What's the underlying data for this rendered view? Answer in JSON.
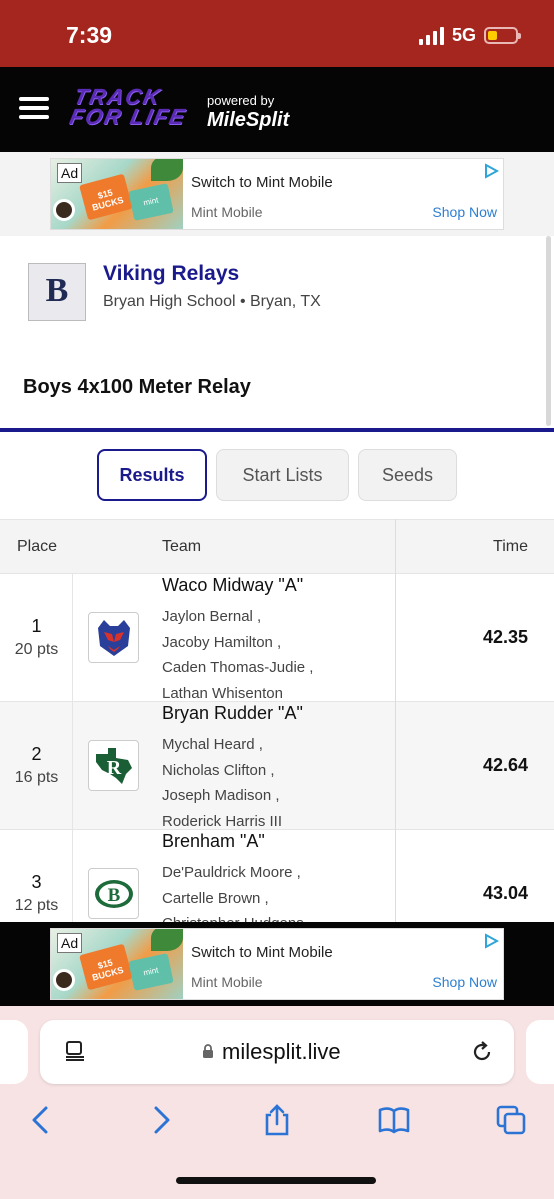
{
  "status": {
    "time": "7:39",
    "network": "5G"
  },
  "header": {
    "logo_line1": "TRACK",
    "logo_line2": "FOR LIFE",
    "powered_by": "powered by",
    "partner": "MileSplit"
  },
  "ad": {
    "badge": "Ad",
    "title": "Switch to Mint Mobile",
    "advertiser": "Mint Mobile",
    "cta": "Shop Now",
    "card1": "$15 BUCKS",
    "card2": "mint"
  },
  "meet": {
    "name": "Viking Relays",
    "location": "Bryan High School • Bryan, TX",
    "logo_letter": "B"
  },
  "event": {
    "title": "Boys 4x100 Meter Relay"
  },
  "tabs": [
    {
      "label": "Results"
    },
    {
      "label": "Start Lists"
    },
    {
      "label": "Seeds"
    }
  ],
  "table": {
    "headers": {
      "place": "Place",
      "team": "Team",
      "time": "Time"
    },
    "rows": [
      {
        "place": "1",
        "points": "20 pts",
        "team": "Waco Midway \"A\"",
        "athletes": [
          "Jaylon Bernal ,",
          "Jacoby Hamilton ,",
          "Caden Thomas-Judie ,",
          "Lathan Whisenton"
        ],
        "time": "42.35"
      },
      {
        "place": "2",
        "points": "16 pts",
        "team": "Bryan Rudder \"A\"",
        "athletes": [
          "Mychal Heard ,",
          "Nicholas Clifton ,",
          "Joseph Madison ,",
          "Roderick Harris III"
        ],
        "time": "42.64"
      },
      {
        "place": "3",
        "points": "12 pts",
        "team": "Brenham \"A\"",
        "athletes": [
          "De'Pauldrick Moore ,",
          "Cartelle Brown ,",
          "Christopher Hudgens"
        ],
        "time": "43.04"
      }
    ]
  },
  "browser": {
    "url": "milesplit.live"
  },
  "colors": {
    "status_bg": "#a5251f",
    "brand_blue": "#1a1a8c",
    "logo_purple": "#5a2bb5",
    "ad_link": "#2d7fd1"
  }
}
